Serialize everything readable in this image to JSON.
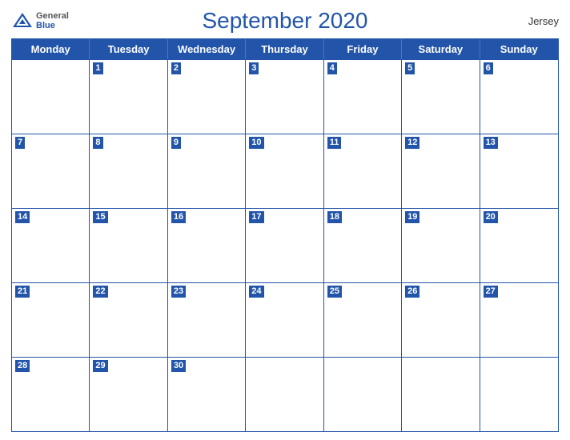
{
  "header": {
    "logo_general": "General",
    "logo_blue": "Blue",
    "title": "September 2020",
    "region": "Jersey"
  },
  "calendar": {
    "day_headers": [
      "Monday",
      "Tuesday",
      "Wednesday",
      "Thursday",
      "Friday",
      "Saturday",
      "Sunday"
    ],
    "weeks": [
      [
        null,
        1,
        2,
        3,
        4,
        5,
        6
      ],
      [
        7,
        8,
        9,
        10,
        11,
        12,
        13
      ],
      [
        14,
        15,
        16,
        17,
        18,
        19,
        20
      ],
      [
        21,
        22,
        23,
        24,
        25,
        26,
        27
      ],
      [
        28,
        29,
        30,
        null,
        null,
        null,
        null
      ]
    ]
  }
}
